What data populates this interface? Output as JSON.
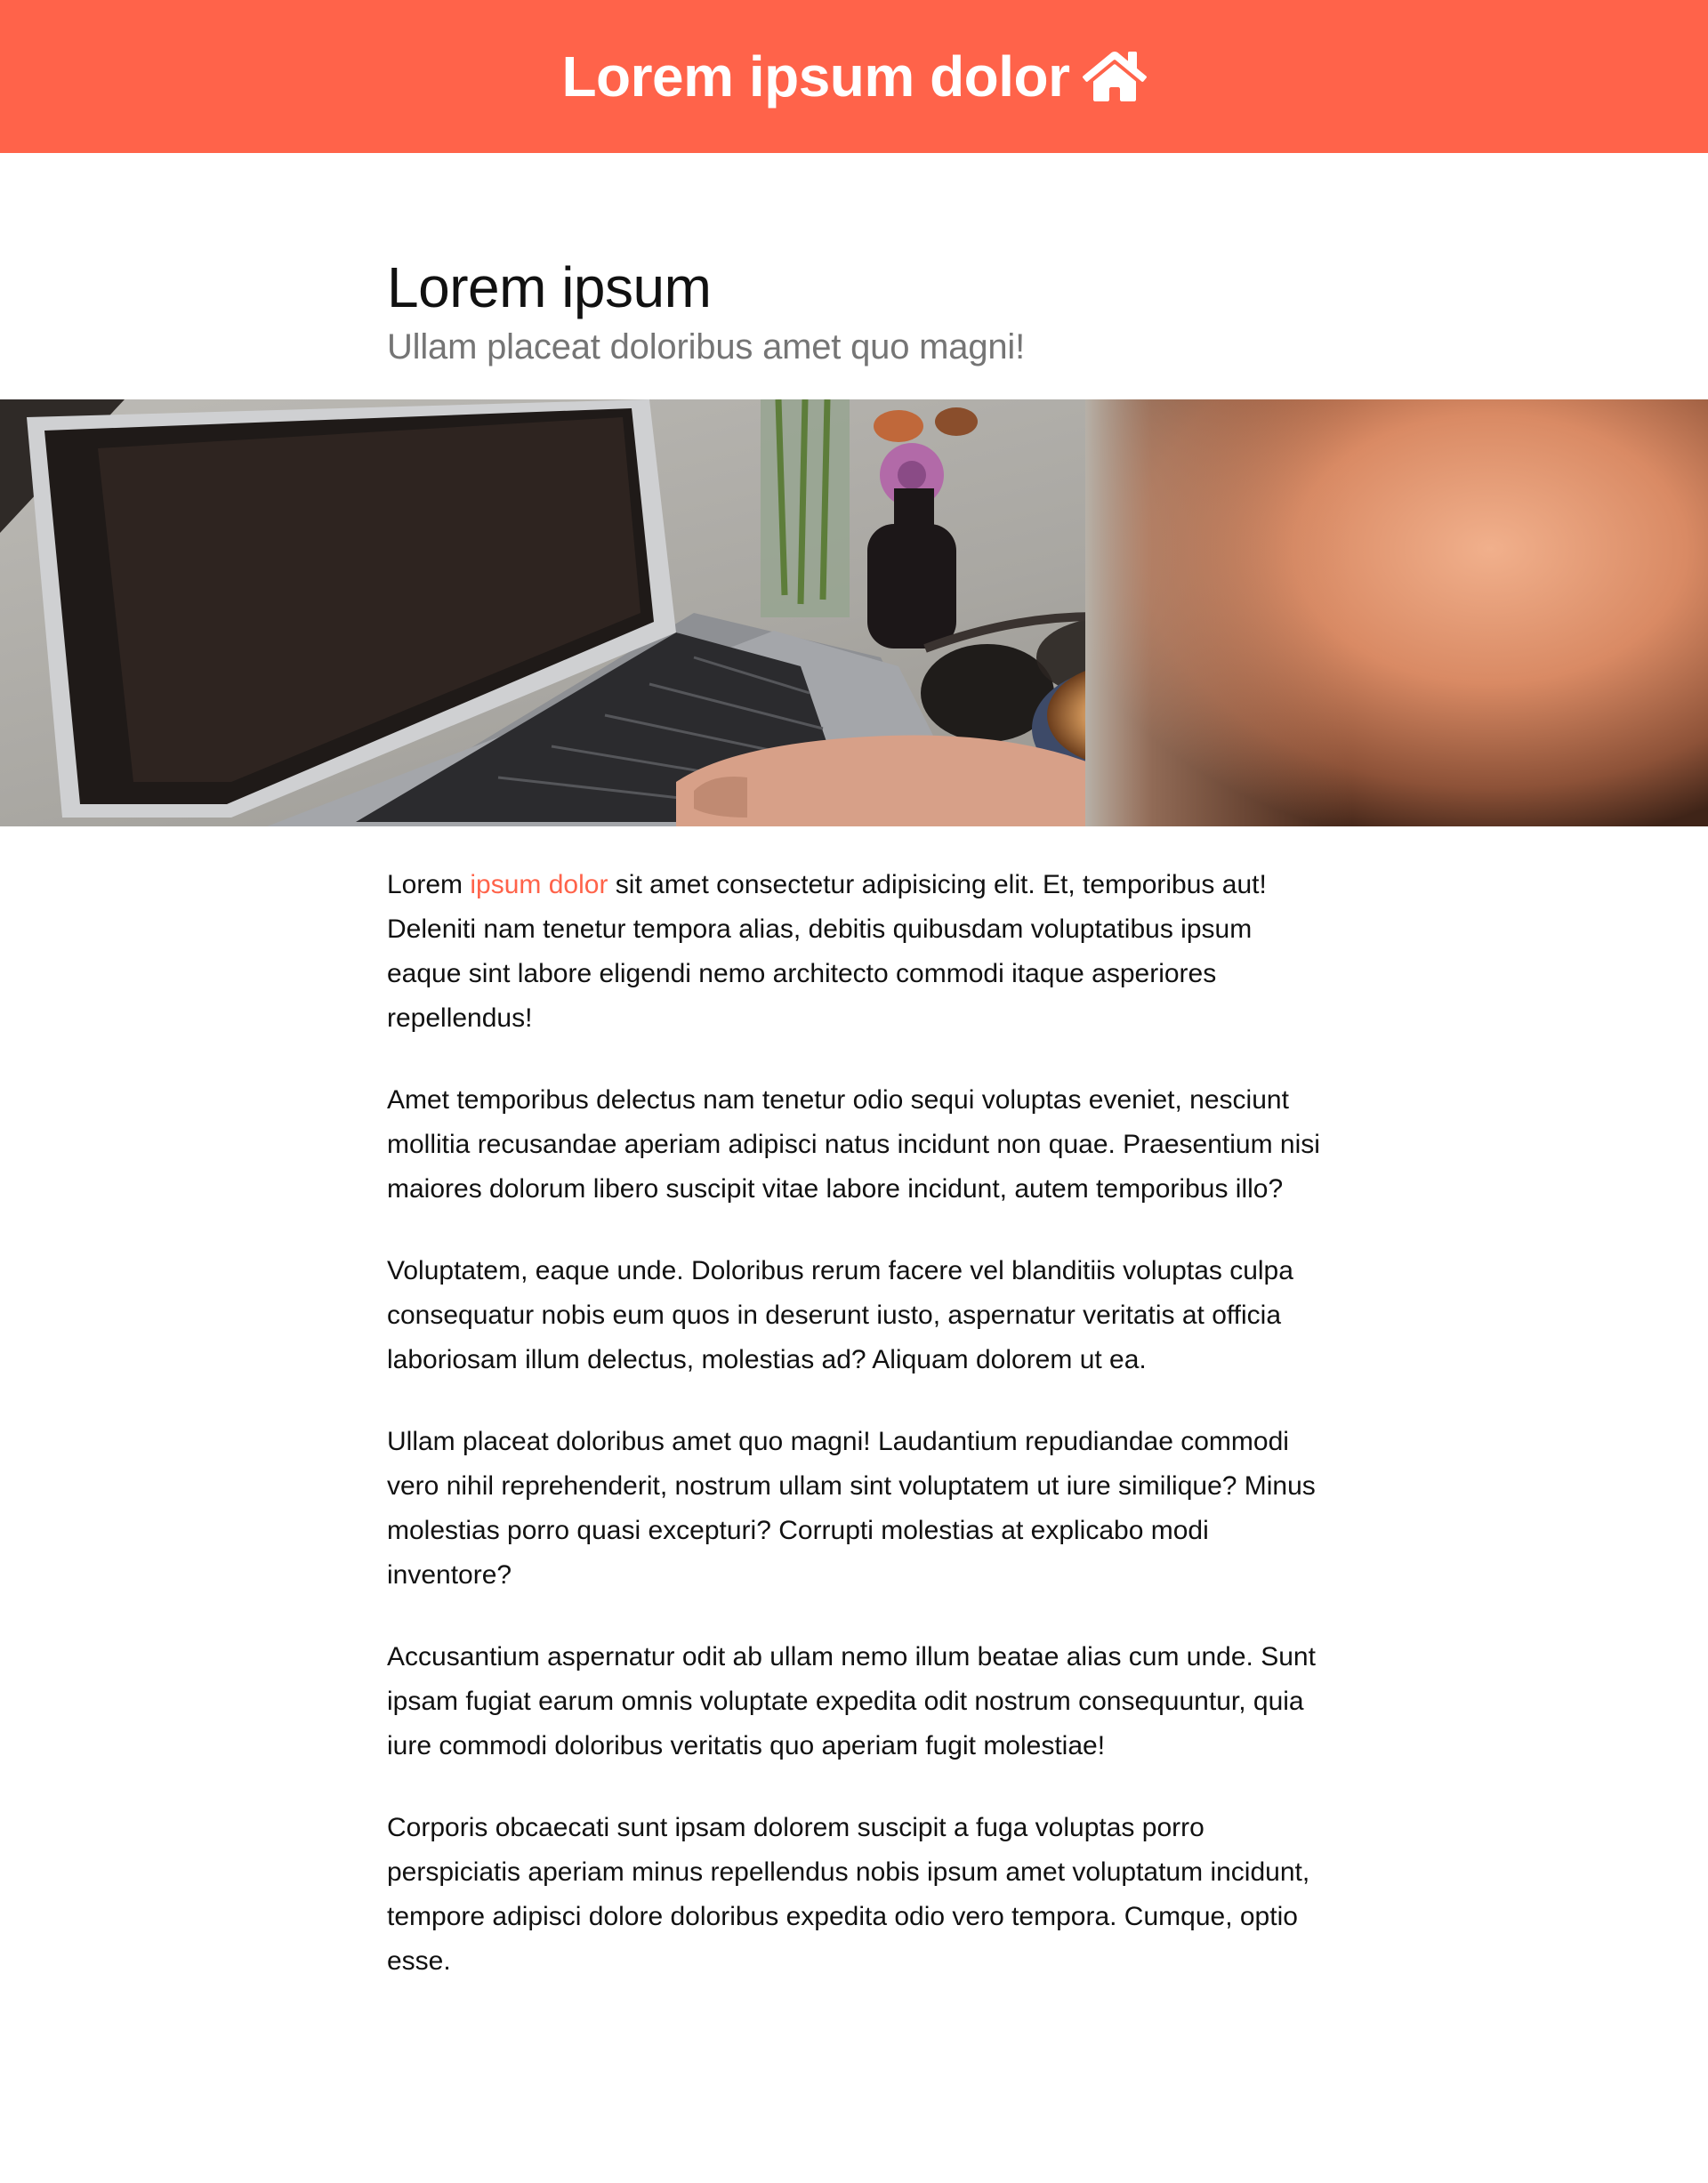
{
  "header": {
    "title": "Lorem ipsum dolor",
    "icon": "home-icon",
    "background_color": "#FF634A"
  },
  "page": {
    "title": "Lorem ipsum",
    "subtitle": "Ullam placeat doloribus amet quo magni!"
  },
  "hero_image": {
    "subject": "laptop, coffee cup, sunglasses and flowers on a table"
  },
  "article": {
    "paragraphs": [
      {
        "before_link": "Lorem ",
        "link": "ipsum dolor",
        "after_link": " sit amet consectetur adipisicing elit. Et, temporibus aut! Deleniti nam tenetur tempora alias, debitis quibusdam voluptatibus ipsum eaque sint labore eligendi nemo architecto commodi itaque asperiores repellendus!"
      },
      "Amet temporibus delectus nam tenetur odio sequi voluptas eveniet, nesciunt mollitia recusandae aperiam adipisci natus incidunt non quae. Praesentium nisi maiores dolorum libero suscipit vitae labore incidunt, autem temporibus illo?",
      "Voluptatem, eaque unde. Doloribus rerum facere vel blanditiis voluptas culpa consequatur nobis eum quos in deserunt iusto, aspernatur veritatis at officia laboriosam illum delectus, molestias ad? Aliquam dolorem ut ea.",
      "Ullam placeat doloribus amet quo magni! Laudantium repudiandae commodi vero nihil reprehenderit, nostrum ullam sint voluptatem ut iure similique? Minus molestias porro quasi excepturi? Corrupti molestias at explicabo modi inventore?",
      "Accusantium aspernatur odit ab ullam nemo illum beatae alias cum unde. Sunt ipsam fugiat earum omnis voluptate expedita odit nostrum consequuntur, quia iure commodi doloribus veritatis quo aperiam fugit molestiae!",
      "Corporis obcaecati sunt ipsam dolorem suscipit a fuga voluptas porro perspiciatis aperiam minus repellendus nobis ipsum amet voluptatum incidunt, tempore adipisci dolore doloribus expedita odio vero tempora. Cumque, optio esse."
    ],
    "link_color": "#FF634A"
  }
}
